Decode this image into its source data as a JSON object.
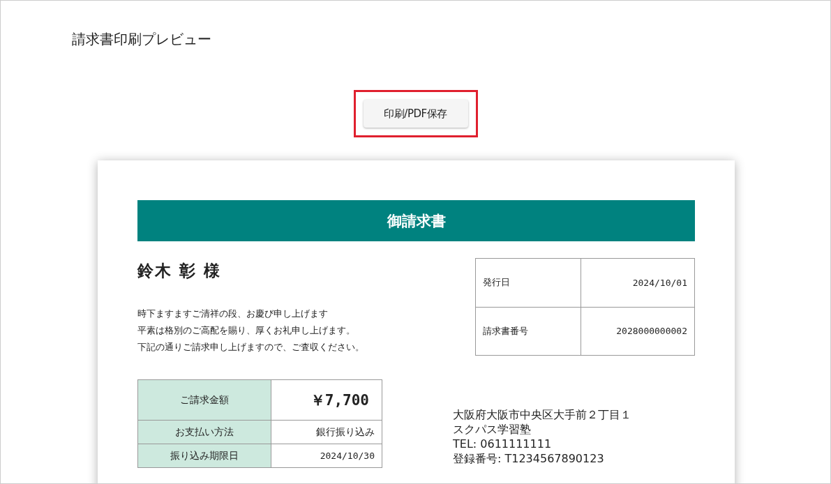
{
  "page_title": "請求書印刷プレビュー",
  "print_button": {
    "label": "印刷/PDF保存",
    "highlighted": true
  },
  "invoice": {
    "heading": "御請求書",
    "recipient": "鈴木 彰 様",
    "greeting": [
      "時下ますますご清祥の段、お慶び申し上げます",
      "平素は格別のご高配を賜り、厚くお礼申し上げます。",
      "下記の通りご請求申し上げますので、ご査収ください。"
    ],
    "info": [
      {
        "label": "発行日",
        "value": "2024/10/01"
      },
      {
        "label": "請求書番号",
        "value": "2028000000002"
      }
    ],
    "summary": [
      {
        "kind": "total",
        "label": "ご請求金額",
        "value": "￥7,700"
      },
      {
        "kind": "plain",
        "label": "お支払い方法",
        "value": "銀行振り込み"
      },
      {
        "kind": "plain",
        "label": "振り込み期限日",
        "value": "2024/10/30"
      }
    ],
    "issuer": [
      "大阪府大阪市中央区大手前２丁目１",
      "スクパス学習塾",
      "TEL: 0611111111",
      "登録番号: T1234567890123"
    ]
  }
}
